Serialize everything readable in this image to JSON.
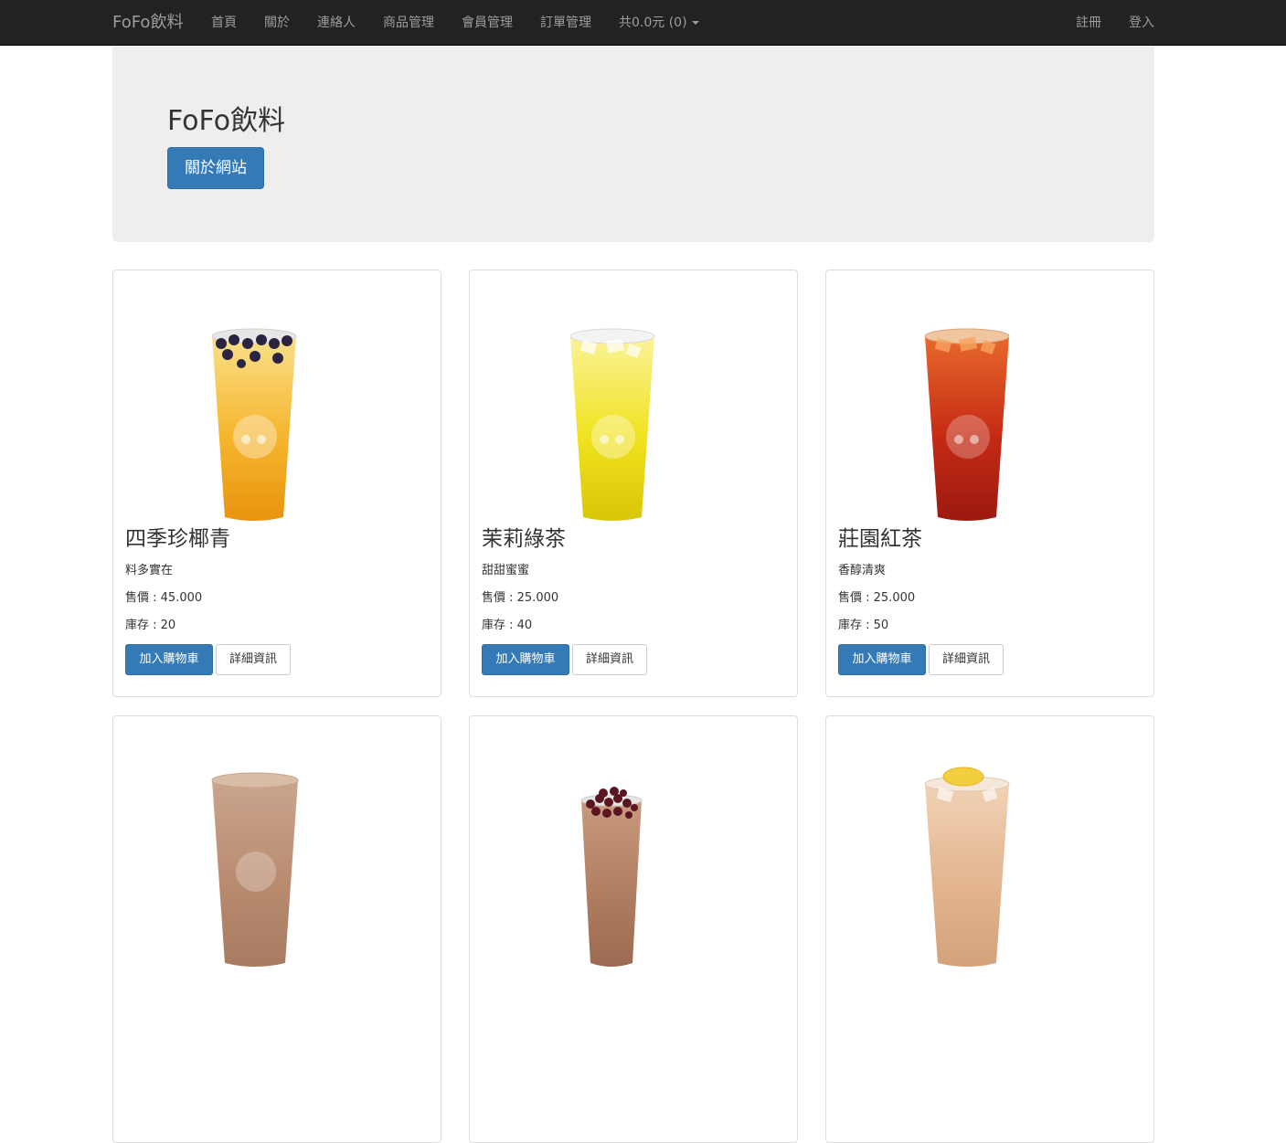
{
  "navbar": {
    "brand": "FoFo飲料",
    "links": [
      "首頁",
      "關於",
      "連絡人",
      "商品管理",
      "會員管理",
      "訂單管理"
    ],
    "cart": "共0.0元 (0)",
    "register": "註冊",
    "login": "登入"
  },
  "jumbotron": {
    "title": "FoFo飲料",
    "button": "關於網站"
  },
  "buttons": {
    "add_to_cart": "加入購物車",
    "details": "詳細資訊"
  },
  "products": [
    {
      "name": "四季珍椰青",
      "desc": "料多實在",
      "price": "售價 : 45.000",
      "stock": "庫存 : 20",
      "image": "golden-tea-with-black-pearls",
      "colors": [
        "#f9e08a",
        "#f6b52e",
        "#e8940f"
      ]
    },
    {
      "name": "茉莉綠茶",
      "desc": "甜甜蜜蜜",
      "price": "售價 : 25.000",
      "stock": "庫存 : 40",
      "image": "jasmine-green-tea-cup",
      "colors": [
        "#fbf39a",
        "#f0e21e",
        "#d9c608"
      ]
    },
    {
      "name": "莊園紅茶",
      "desc": "香醇清爽",
      "price": "售價 : 25.000",
      "stock": "庫存 : 50",
      "image": "black-tea-cup",
      "colors": [
        "#e8682b",
        "#c42a14",
        "#9c1a10"
      ]
    },
    {
      "name": "",
      "desc": "",
      "price": "",
      "stock": "",
      "image": "milk-tea-cup",
      "colors": [
        "#c9a58c",
        "#b98c70",
        "#a87a60"
      ]
    },
    {
      "name": "",
      "desc": "",
      "price": "",
      "stock": "",
      "image": "red-bean-milk-tea-cup",
      "colors": [
        "#c99a80",
        "#b17e62",
        "#9a6a50"
      ]
    },
    {
      "name": "",
      "desc": "",
      "price": "",
      "stock": "",
      "image": "lemon-milk-tea-cup",
      "colors": [
        "#f1d2b5",
        "#e2b590",
        "#d3a27a"
      ]
    }
  ]
}
